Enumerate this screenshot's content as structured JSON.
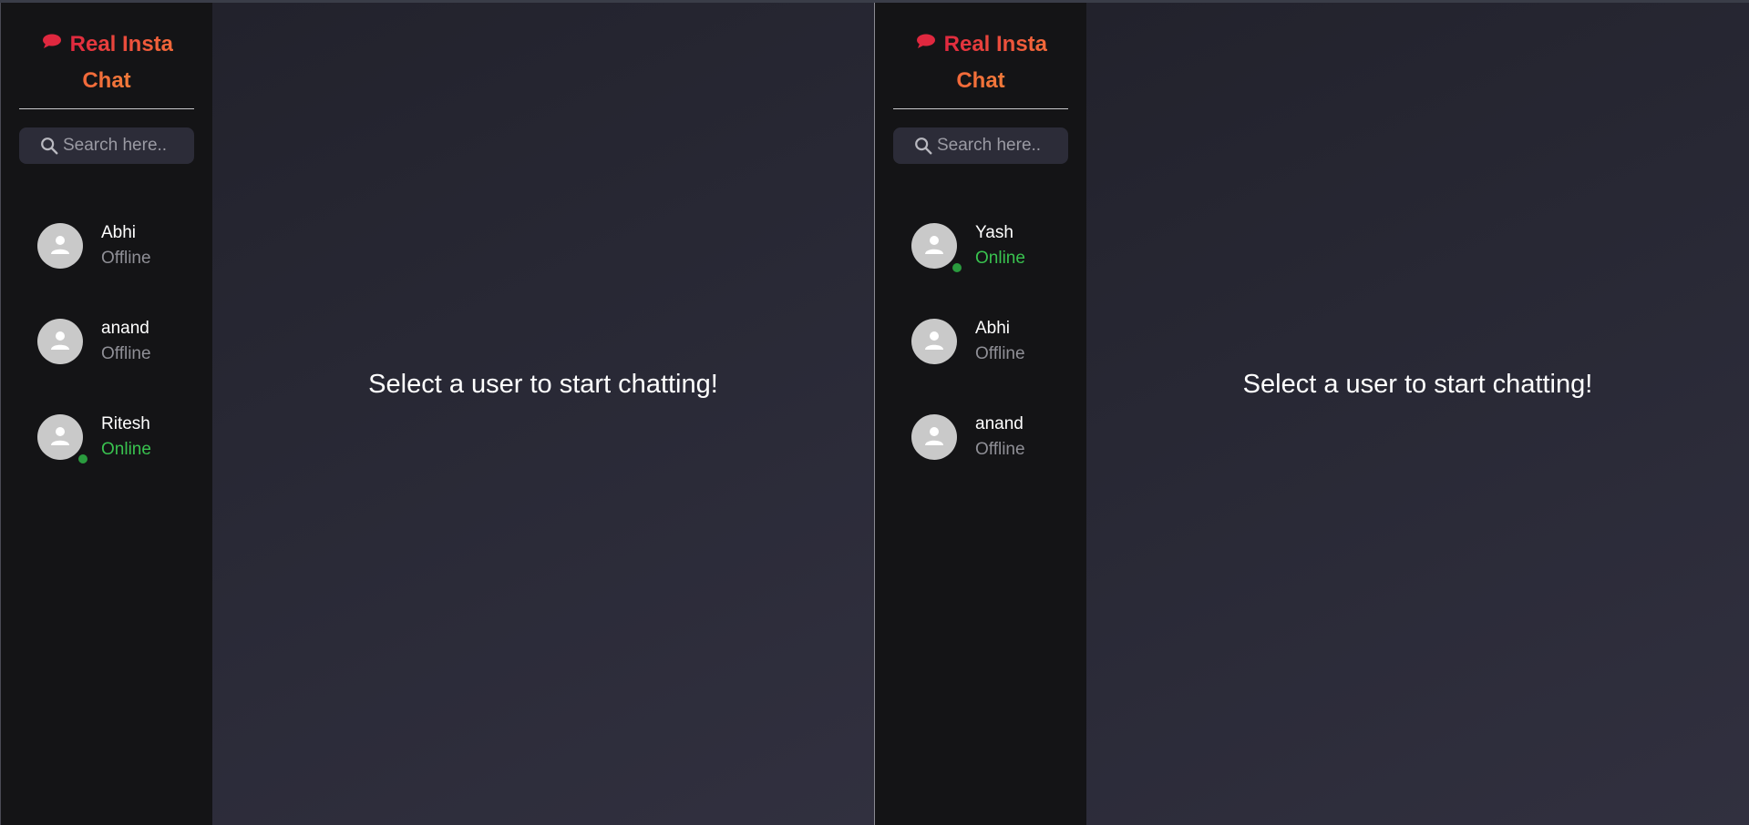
{
  "panes": [
    {
      "brand": {
        "title": "Real Insta Chat",
        "icon": "chat-bubble-icon",
        "gradient": [
          "#e0283f",
          "#f27a3a"
        ]
      },
      "search": {
        "placeholder": "Search here..",
        "value": ""
      },
      "users": [
        {
          "name": "Abhi",
          "status": "Offline",
          "online": false
        },
        {
          "name": "anand",
          "status": "Offline",
          "online": false
        },
        {
          "name": "Ritesh",
          "status": "Online",
          "online": true
        }
      ],
      "main": {
        "empty_message": "Select a user to start chatting!"
      }
    },
    {
      "brand": {
        "title": "Real Insta Chat",
        "icon": "chat-bubble-icon",
        "gradient": [
          "#e0283f",
          "#f27a3a"
        ]
      },
      "search": {
        "placeholder": "Search here..",
        "value": ""
      },
      "users": [
        {
          "name": "Yash",
          "status": "Online",
          "online": true
        },
        {
          "name": "Abhi",
          "status": "Offline",
          "online": false
        },
        {
          "name": "anand",
          "status": "Offline",
          "online": false
        }
      ],
      "main": {
        "empty_message": "Select a user to start chatting!"
      }
    }
  ],
  "colors": {
    "online": "#39c24f",
    "offline": "#8f8f96",
    "sidebar_bg": "#141416",
    "main_bg": "#2a2a37"
  }
}
